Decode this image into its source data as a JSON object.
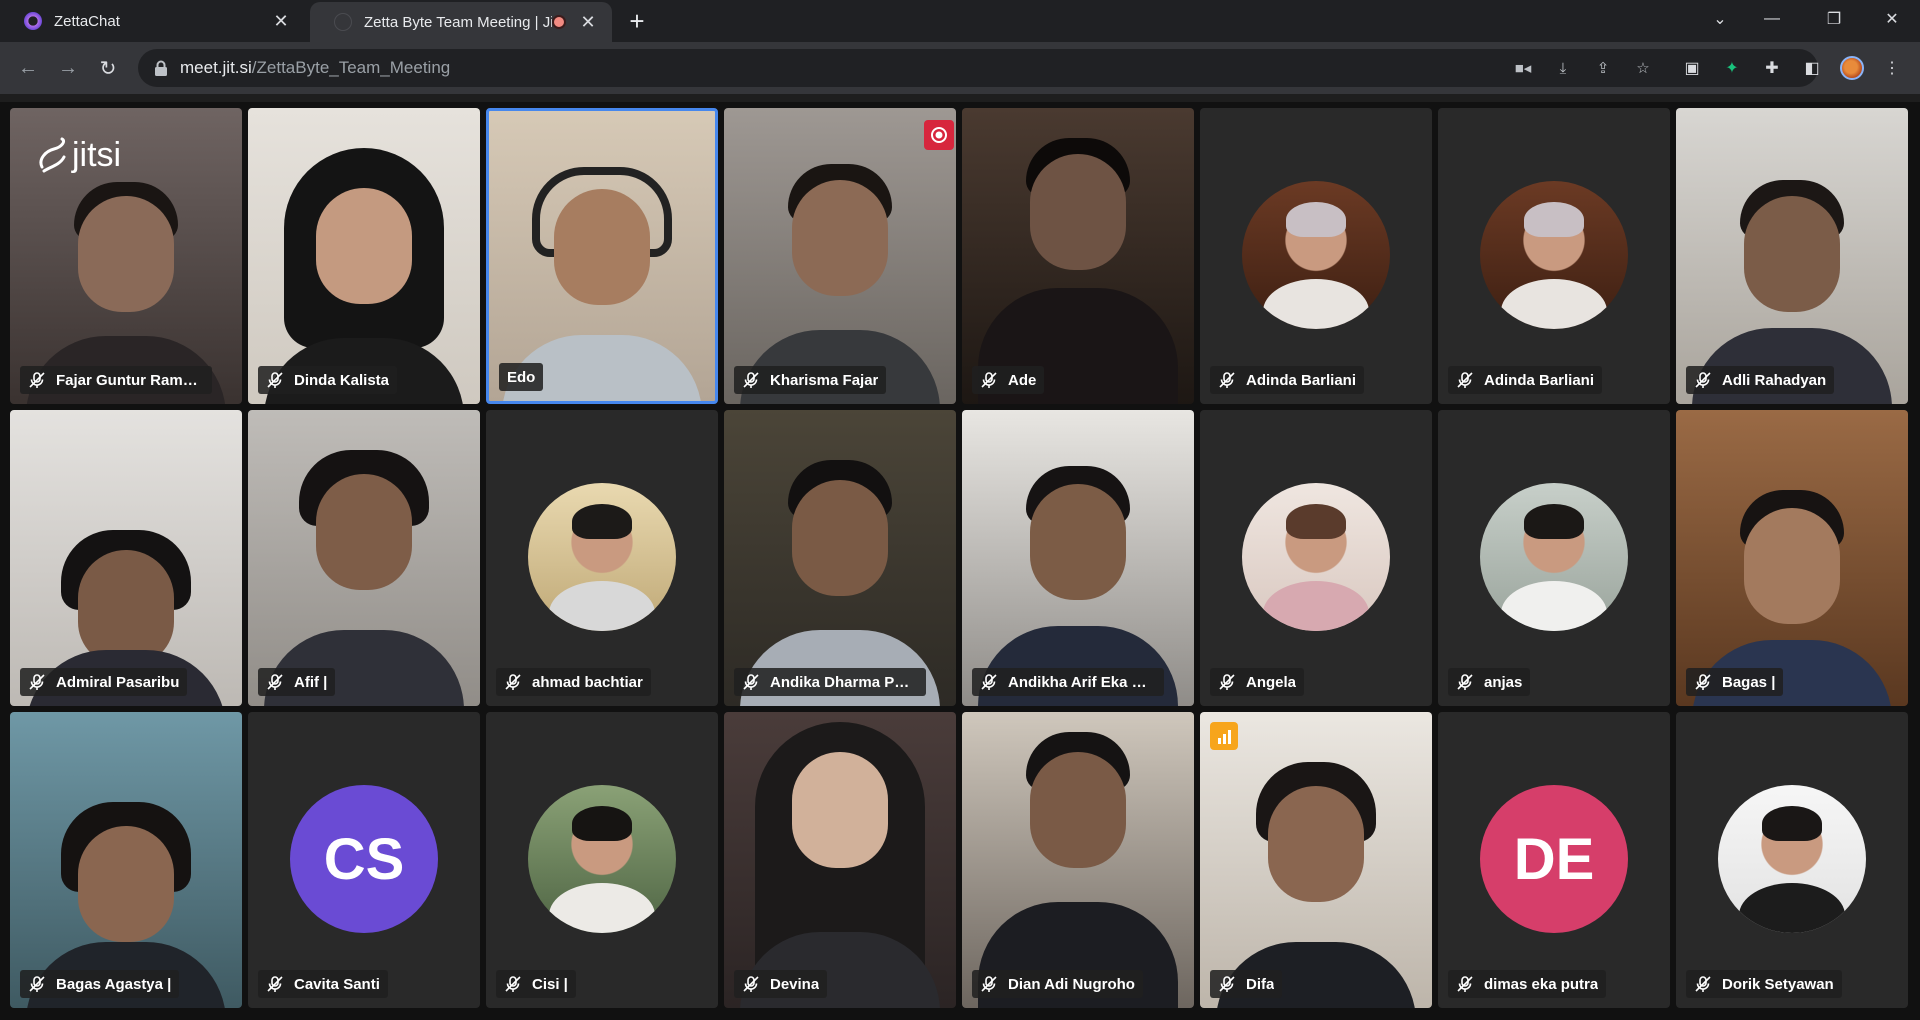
{
  "browser": {
    "tabs": [
      {
        "title": "ZettaChat",
        "active": false
      },
      {
        "title": "Zetta Byte Team Meeting | Jitsi Meet",
        "active": true,
        "recording": true
      }
    ],
    "url_host": "meet.jit.si",
    "url_path": "/ZettaByte_Team_Meeting"
  },
  "meeting": {
    "logo_text": "jitsi",
    "participants": [
      {
        "name": "Fajar Guntur Ramadhan",
        "display": "Fajar Guntur Ramad...",
        "kind": "video",
        "muted": true
      },
      {
        "name": "Dinda Kalista",
        "display": "Dinda Kalista",
        "kind": "video",
        "muted": true
      },
      {
        "name": "Edo",
        "display": "Edo",
        "kind": "video",
        "muted": false,
        "dominant": true
      },
      {
        "name": "Kharisma Fajar",
        "display": "Kharisma Fajar",
        "kind": "video",
        "muted": true,
        "recording_indicator": true
      },
      {
        "name": "Ade",
        "display": "Ade",
        "kind": "video",
        "muted": true
      },
      {
        "name": "Adinda Barliani",
        "display": "Adinda Barliani",
        "kind": "avatar-photo",
        "muted": true
      },
      {
        "name": "Adinda Barliani",
        "display": "Adinda Barliani",
        "kind": "avatar-photo",
        "muted": true
      },
      {
        "name": "Adli Rahadyan",
        "display": "Adli Rahadyan",
        "kind": "video",
        "muted": true
      },
      {
        "name": "Admiral Pasaribu",
        "display": "Admiral Pasaribu",
        "kind": "video",
        "muted": true
      },
      {
        "name": "Afif |",
        "display": "Afif |",
        "kind": "video",
        "muted": true
      },
      {
        "name": "ahmad bachtiar",
        "display": "ahmad bachtiar",
        "kind": "avatar-photo",
        "muted": true
      },
      {
        "name": "Andika Dharma Putra",
        "display": "Andika Dharma Putra",
        "kind": "video",
        "muted": true
      },
      {
        "name": "Andikha Arif Eka Putra",
        "display": "Andikha Arif Eka Pu...",
        "kind": "video",
        "muted": true
      },
      {
        "name": "Angela",
        "display": "Angela",
        "kind": "avatar-photo",
        "muted": true
      },
      {
        "name": "anjas",
        "display": "anjas",
        "kind": "avatar-photo",
        "muted": true
      },
      {
        "name": "Bagas |",
        "display": "Bagas |",
        "kind": "video",
        "muted": true
      },
      {
        "name": "Bagas Agastya |",
        "display": "Bagas Agastya |",
        "kind": "video",
        "muted": true
      },
      {
        "name": "Cavita Santi",
        "display": "Cavita Santi",
        "kind": "initials",
        "initials": "CS",
        "avatar_color": "#6a4bd4",
        "muted": true
      },
      {
        "name": "Cisi |",
        "display": "Cisi |",
        "kind": "avatar-photo",
        "muted": true
      },
      {
        "name": "Devina",
        "display": "Devina",
        "kind": "video",
        "muted": true
      },
      {
        "name": "Dian Adi Nugroho",
        "display": "Dian Adi Nugroho",
        "kind": "video",
        "muted": true
      },
      {
        "name": "Difa",
        "display": "Difa",
        "kind": "video",
        "muted": true,
        "poor_connection": true
      },
      {
        "name": "dimas eka putra",
        "display": "dimas eka putra",
        "kind": "initials",
        "initials": "DE",
        "avatar_color": "#d63e6a",
        "muted": true
      },
      {
        "name": "Dorik Setyawan",
        "display": "Dorik Setyawan",
        "kind": "avatar-photo",
        "muted": true
      }
    ]
  },
  "colors": {
    "dominant_border": "#4687ed",
    "recording": "#d7263d",
    "connection_warning": "#f7a51c",
    "tile_background": "#292929"
  }
}
